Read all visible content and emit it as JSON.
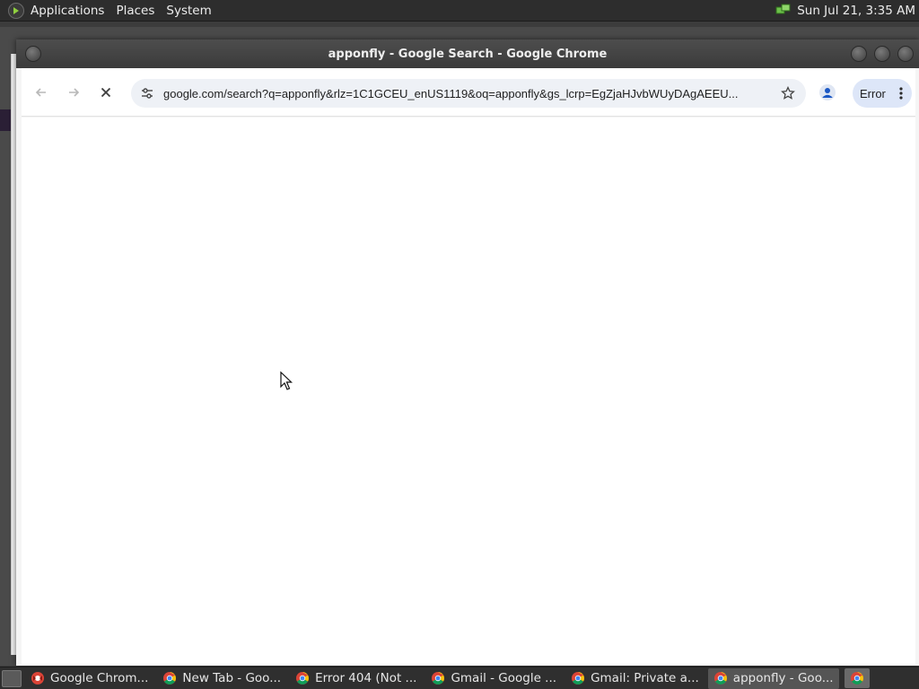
{
  "top_panel": {
    "menus": [
      "Applications",
      "Places",
      "System"
    ],
    "clock": "Sun Jul 21,  3:35 AM"
  },
  "window": {
    "title": "apponfly - Google Search - Google Chrome"
  },
  "toolbar": {
    "url": "google.com/search?q=apponfly&rlz=1C1GCEU_enUS1119&oq=apponfly&gs_lcrp=EgZjaHJvbWUyDAgAEEU...",
    "error_label": "Error"
  },
  "taskbar": {
    "tasks": [
      {
        "label": "Google Chrom...",
        "icon": "chrome-red-icon",
        "active": false
      },
      {
        "label": "New Tab - Goo...",
        "icon": "chrome-icon",
        "active": false
      },
      {
        "label": "Error 404 (Not ...",
        "icon": "chrome-icon",
        "active": false
      },
      {
        "label": "Gmail - Google ...",
        "icon": "chrome-icon",
        "active": false
      },
      {
        "label": "Gmail: Private a...",
        "icon": "chrome-icon",
        "active": false
      },
      {
        "label": "apponfly - Goo...",
        "icon": "chrome-icon",
        "active": true
      }
    ]
  },
  "colors": {
    "panel_bg": "#2d2d2d",
    "omnibox_bg": "#eef1f6",
    "error_chip_bg": "#dde6f8",
    "chrome_red": "#db4437",
    "chrome_yellow": "#f4c20d",
    "chrome_green": "#0f9d58",
    "chrome_blue": "#4285f4"
  }
}
